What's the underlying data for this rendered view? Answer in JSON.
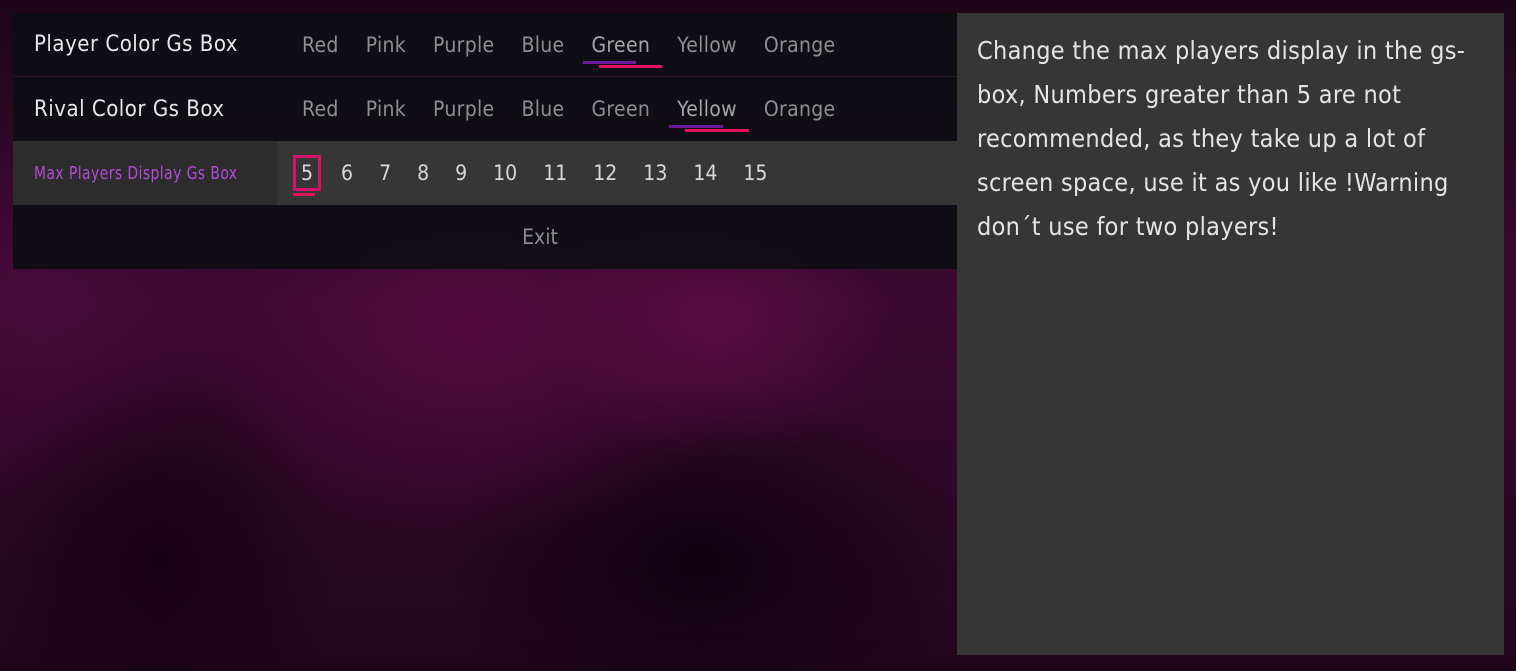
{
  "menu": {
    "rows": [
      {
        "label": "Player Color Gs Box",
        "options": [
          "Red",
          "Pink",
          "Purple",
          "Blue",
          "Green",
          "Yellow",
          "Orange"
        ],
        "selected": "Green"
      },
      {
        "label": "Rival Color Gs Box",
        "options": [
          "Red",
          "Pink",
          "Purple",
          "Blue",
          "Green",
          "Yellow",
          "Orange"
        ],
        "selected": "Yellow"
      },
      {
        "label": "Max Players Display Gs Box",
        "options": [
          "5",
          "6",
          "7",
          "8",
          "9",
          "10",
          "11",
          "12",
          "13",
          "14",
          "15"
        ],
        "selected": "5"
      }
    ],
    "exit_label": "Exit"
  },
  "description": "Change the max players display in the gs-box, Numbers greater than 5 are not recommended, as they take up a lot of screen space, use it as you like !Warning don´t use for two players!",
  "colors": {
    "focus_label": "#b24cd6",
    "selection_underline": "#e0105a",
    "selection_underline_secondary": "#6a1a9a",
    "panel": "#363636"
  }
}
